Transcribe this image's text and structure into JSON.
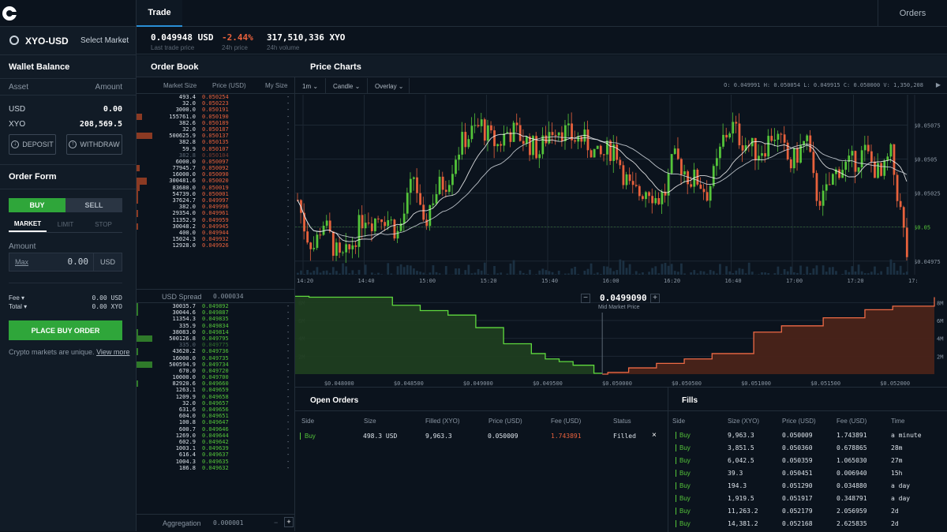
{
  "nav": {
    "trade_tab": "Trade",
    "orders_tab": "Orders"
  },
  "product": {
    "name": "XYO-USD",
    "select_market": "Select Market"
  },
  "ticker": {
    "last_price": "0.049948 USD",
    "last_price_label": "Last trade price",
    "change": "-2.44%",
    "change_label": "24h price",
    "volume": "317,510,336 XYO",
    "volume_label": "24h volume"
  },
  "wallet": {
    "title": "Wallet Balance",
    "asset_header": "Asset",
    "amount_header": "Amount",
    "rows": [
      {
        "asset": "USD",
        "amount": "0.00"
      },
      {
        "asset": "XYO",
        "amount": "208,569.5"
      }
    ],
    "deposit": "DEPOSIT",
    "withdraw": "WITHDRAW"
  },
  "order_form": {
    "title": "Order Form",
    "buy": "BUY",
    "sell": "SELL",
    "market": "MARKET",
    "limit": "LIMIT",
    "stop": "STOP",
    "amount_label": "Amount",
    "max": "Max",
    "amount_value": "0.00",
    "amount_unit": "USD",
    "fee_label": "Fee",
    "fee_value": "0.00 USD",
    "total_label": "Total",
    "total_value": "0.00 XYO",
    "place_order": "PLACE BUY ORDER",
    "hint": "Crypto markets are unique.",
    "view_more": "View more"
  },
  "order_book": {
    "title": "Order Book",
    "col_size": "Market Size",
    "col_price": "Price (USD)",
    "col_mine": "My Size",
    "spread_label": "USD Spread",
    "spread_value": "0.000034",
    "aggregation_label": "Aggregation",
    "aggregation_value": "0.000001",
    "minus": "−",
    "plus": "+",
    "asks": [
      {
        "size": "493.4",
        "price": "0.050254",
        "depth": 0
      },
      {
        "size": "32.0",
        "price": "0.050223",
        "depth": 0
      },
      {
        "size": "3000.0",
        "price": "0.050191",
        "depth": 0
      },
      {
        "size": "155761.0",
        "price": "0.050190",
        "depth": 3
      },
      {
        "size": "382.6",
        "price": "0.050189",
        "depth": 0
      },
      {
        "size": "32.0",
        "price": "0.050187",
        "depth": 0
      },
      {
        "size": "500625.9",
        "price": "0.050137",
        "depth": 9
      },
      {
        "size": "382.8",
        "price": "0.050135",
        "depth": 0
      },
      {
        "size": "59.9",
        "price": "0.050107",
        "depth": 0
      },
      {
        "size": "382.8",
        "price": "0.050104",
        "depth": 0,
        "dim": true
      },
      {
        "size": "6000.0",
        "price": "0.050097",
        "depth": 0
      },
      {
        "size": "77945.7",
        "price": "0.050092",
        "depth": 2
      },
      {
        "size": "16000.0",
        "price": "0.050090",
        "depth": 0
      },
      {
        "size": "300481.6",
        "price": "0.050020",
        "depth": 6
      },
      {
        "size": "83680.0",
        "price": "0.050019",
        "depth": 2
      },
      {
        "size": "54739.0",
        "price": "0.050001",
        "depth": 1
      },
      {
        "size": "37624.7",
        "price": "0.049997",
        "depth": 1
      },
      {
        "size": "382.0",
        "price": "0.049996",
        "depth": 0
      },
      {
        "size": "29354.0",
        "price": "0.049961",
        "depth": 1
      },
      {
        "size": "11352.9",
        "price": "0.049959",
        "depth": 0
      },
      {
        "size": "30048.2",
        "price": "0.049945",
        "depth": 1
      },
      {
        "size": "400.0",
        "price": "0.049944",
        "depth": 0
      },
      {
        "size": "15024.3",
        "price": "0.049932",
        "depth": 0
      },
      {
        "size": "12928.0",
        "price": "0.049926",
        "depth": 0
      }
    ],
    "bids": [
      {
        "size": "30035.7",
        "price": "0.049892",
        "depth": 1
      },
      {
        "size": "30044.6",
        "price": "0.049887",
        "depth": 1
      },
      {
        "size": "11354.3",
        "price": "0.049835",
        "depth": 0
      },
      {
        "size": "335.9",
        "price": "0.049834",
        "depth": 0
      },
      {
        "size": "38083.0",
        "price": "0.049814",
        "depth": 1
      },
      {
        "size": "500126.8",
        "price": "0.049795",
        "depth": 9
      },
      {
        "size": "335.0",
        "price": "0.049775",
        "depth": 0,
        "dim": true
      },
      {
        "size": "43620.2",
        "price": "0.049736",
        "depth": 1
      },
      {
        "size": "16000.0",
        "price": "0.049735",
        "depth": 0
      },
      {
        "size": "500594.9",
        "price": "0.049734",
        "depth": 9
      },
      {
        "size": "670.0",
        "price": "0.049720",
        "depth": 0
      },
      {
        "size": "10000.0",
        "price": "0.049700",
        "depth": 0
      },
      {
        "size": "82920.6",
        "price": "0.049660",
        "depth": 1
      },
      {
        "size": "1263.1",
        "price": "0.049659",
        "depth": 0
      },
      {
        "size": "1209.9",
        "price": "0.049658",
        "depth": 0
      },
      {
        "size": "32.0",
        "price": "0.049657",
        "depth": 0
      },
      {
        "size": "631.6",
        "price": "0.049656",
        "depth": 0
      },
      {
        "size": "604.0",
        "price": "0.049651",
        "depth": 0
      },
      {
        "size": "100.8",
        "price": "0.049647",
        "depth": 0
      },
      {
        "size": "600.7",
        "price": "0.049646",
        "depth": 0
      },
      {
        "size": "1269.0",
        "price": "0.049644",
        "depth": 0
      },
      {
        "size": "602.9",
        "price": "0.049642",
        "depth": 0
      },
      {
        "size": "1003.1",
        "price": "0.049639",
        "depth": 0
      },
      {
        "size": "616.4",
        "price": "0.049637",
        "depth": 0
      },
      {
        "size": "1004.3",
        "price": "0.049635",
        "depth": 0
      },
      {
        "size": "186.8",
        "price": "0.049632",
        "depth": 0
      }
    ],
    "mine": "-"
  },
  "price_chart": {
    "title": "Price Charts",
    "interval": "1m",
    "type": "Candle",
    "overlay": "Overlay",
    "ohlc": "O: 0.049991  H: 0.050054  L: 0.049915  C: 0.050000  V: 1,350,208"
  },
  "colors": {
    "up": "#54c53a",
    "down": "#e8613c",
    "accent": "#2a8fd6",
    "buy_button": "#2fa63a"
  },
  "chart_data": [
    {
      "type": "candlestick",
      "x_ticks": [
        "14:20",
        "14:40",
        "15:00",
        "15:20",
        "15:40",
        "16:00",
        "16:20",
        "16:40",
        "17:00",
        "17:20",
        "17:"
      ],
      "y_ticks": [
        "$0.05075",
        "$0.0505",
        "$0.05025",
        "$0.05",
        "$0.04975"
      ],
      "ylim": [
        0.04965,
        0.05095
      ],
      "last_price": 0.05,
      "close_series": [
        0.0502,
        0.04995,
        0.04985,
        0.05005,
        0.0499,
        0.04975,
        0.0498,
        0.04995,
        0.0501,
        0.05005,
        0.0501,
        0.05005,
        0.04995,
        0.05015,
        0.0504,
        0.04995,
        0.0502,
        0.0503,
        0.05035,
        0.05055,
        0.05065,
        0.0507,
        0.05075,
        0.05065,
        0.0506,
        0.0507,
        0.0507,
        0.05065,
        0.0506,
        0.05055,
        0.0507,
        0.05075,
        0.0507,
        0.05065,
        0.05065,
        0.0506,
        0.0505,
        0.05055,
        0.0506,
        0.0504,
        0.05025,
        0.05025,
        0.0503,
        0.0502,
        0.05025,
        0.0505,
        0.05045,
        0.05035,
        0.05035,
        0.05025,
        0.0504,
        0.05065,
        0.05075,
        0.05065,
        0.0506,
        0.05055,
        0.0506,
        0.0507,
        0.0506,
        0.05045,
        0.05055,
        0.05065,
        0.05025,
        0.0502,
        0.05035,
        0.05045,
        0.05045,
        0.0505,
        0.05055,
        0.05045,
        0.05035,
        0.05055,
        0.0502,
        0.0498
      ]
    },
    {
      "type": "depth",
      "x_ticks": [
        "$0.048000",
        "$0.048500",
        "$0.049000",
        "$0.049500",
        "$0.050000",
        "$0.050500",
        "$0.051000",
        "$0.051500",
        "$0.052000"
      ],
      "y_ticks": [
        "8M",
        "6M",
        "4M",
        "2M"
      ],
      "ylim": [
        0,
        9
      ],
      "mid_price": "0.0499090",
      "mid_label": "Mid Market Price",
      "bids": {
        "price": [
          0.0477,
          0.0478,
          0.0482,
          0.0484,
          0.0486,
          0.0488,
          0.049,
          0.0492,
          0.0494,
          0.0495,
          0.0496,
          0.0497,
          0.04985,
          0.04991
        ],
        "cum_millions": [
          8.7,
          8.6,
          8.6,
          7.7,
          7.1,
          6.6,
          5.2,
          3.4,
          2.3,
          1.7,
          1.4,
          1.0,
          0.1,
          0
        ]
      },
      "asks": {
        "price": [
          0.04991,
          0.04995,
          0.0501,
          0.0503,
          0.0505,
          0.0507,
          0.051,
          0.0512,
          0.0515,
          0.0518,
          0.052,
          0.0523
        ],
        "cum_millions": [
          0,
          0.2,
          0.7,
          1.2,
          1.7,
          2.3,
          4.7,
          5.4,
          6.3,
          7.2,
          7.6,
          8.6
        ]
      }
    }
  ],
  "open_orders": {
    "title": "Open Orders",
    "headers": [
      "Side",
      "Size",
      "Filled (XYO)",
      "Price (USD)",
      "Fee (USD)",
      "Status"
    ],
    "rows": [
      {
        "side": "Buy",
        "size": "498.3 USD",
        "filled": "9,963.3",
        "price": "0.050009",
        "fee": "1.743891",
        "status": "Filled"
      }
    ],
    "close": "×"
  },
  "fills": {
    "title": "Fills",
    "headers": [
      "Side",
      "Size (XYO)",
      "Price (USD)",
      "Fee (USD)",
      "Time"
    ],
    "rows": [
      {
        "side": "Buy",
        "size": "9,963.3",
        "price": "0.050009",
        "fee": "1.743891",
        "time": "a minute"
      },
      {
        "side": "Buy",
        "size": "3,851.5",
        "price": "0.050360",
        "fee": "0.678865",
        "time": "28m"
      },
      {
        "side": "Buy",
        "size": "6,042.5",
        "price": "0.050359",
        "fee": "1.065030",
        "time": "27m"
      },
      {
        "side": "Buy",
        "size": "39.3",
        "price": "0.050451",
        "fee": "0.006940",
        "time": "15h"
      },
      {
        "side": "Buy",
        "size": "194.3",
        "price": "0.051290",
        "fee": "0.034880",
        "time": "a day"
      },
      {
        "side": "Buy",
        "size": "1,919.5",
        "price": "0.051917",
        "fee": "0.348791",
        "time": "a day"
      },
      {
        "side": "Buy",
        "size": "11,263.2",
        "price": "0.052179",
        "fee": "2.056959",
        "time": "2d"
      },
      {
        "side": "Buy",
        "size": "14,381.2",
        "price": "0.052168",
        "fee": "2.625835",
        "time": "2d"
      }
    ]
  }
}
